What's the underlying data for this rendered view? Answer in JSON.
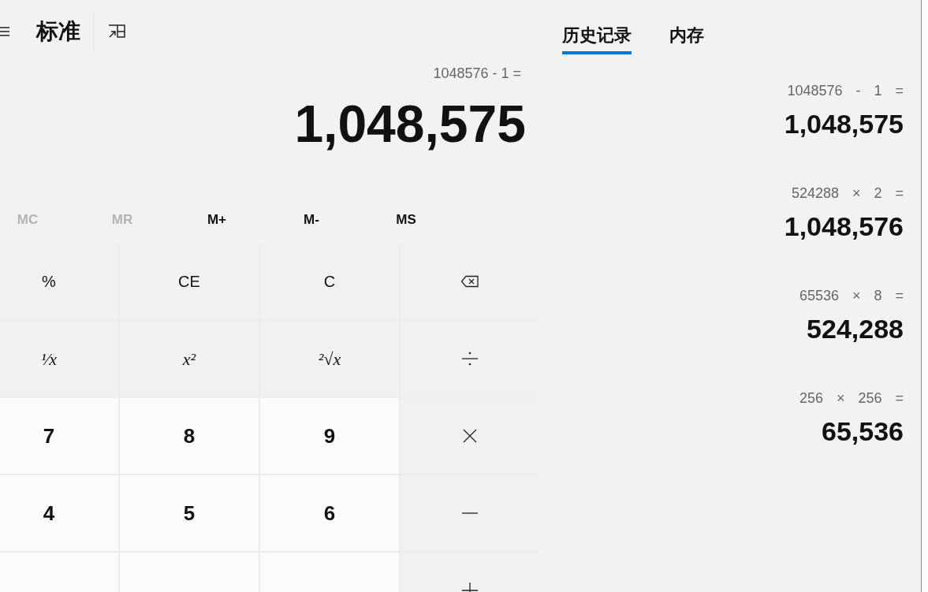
{
  "header": {
    "title": "标准"
  },
  "display": {
    "expression": "1048576 - 1 =",
    "result": "1,048,575"
  },
  "memory": [
    {
      "label": "MC",
      "disabled": true
    },
    {
      "label": "MR",
      "disabled": true
    },
    {
      "label": "M+",
      "disabled": false
    },
    {
      "label": "M-",
      "disabled": false
    },
    {
      "label": "MS",
      "disabled": false
    }
  ],
  "keys": [
    {
      "kind": "function",
      "label": "%"
    },
    {
      "kind": "function",
      "label": "CE"
    },
    {
      "kind": "function",
      "label": "C"
    },
    {
      "kind": "backspace"
    },
    {
      "kind": "math",
      "label": "¹⁄x"
    },
    {
      "kind": "math",
      "label": "x²"
    },
    {
      "kind": "math",
      "label": "²√x"
    },
    {
      "kind": "divide"
    },
    {
      "kind": "digit",
      "label": "7"
    },
    {
      "kind": "digit",
      "label": "8"
    },
    {
      "kind": "digit",
      "label": "9"
    },
    {
      "kind": "multiply"
    },
    {
      "kind": "digit",
      "label": "4"
    },
    {
      "kind": "digit",
      "label": "5"
    },
    {
      "kind": "digit",
      "label": "6"
    },
    {
      "kind": "minus"
    },
    {
      "kind": "digit"
    },
    {
      "kind": "digit"
    },
    {
      "kind": "digit"
    },
    {
      "kind": "plus"
    }
  ],
  "tabs": [
    {
      "label": "历史记录",
      "selected": true
    },
    {
      "label": "内存",
      "selected": false
    }
  ],
  "history": [
    {
      "expression": "1048576 - 1 =",
      "result": "1,048,575"
    },
    {
      "expression": "524288 × 2 =",
      "result": "1,048,576"
    },
    {
      "expression": "65536 × 8 =",
      "result": "524,288"
    },
    {
      "expression": "256 × 256 =",
      "result": "65,536"
    }
  ]
}
